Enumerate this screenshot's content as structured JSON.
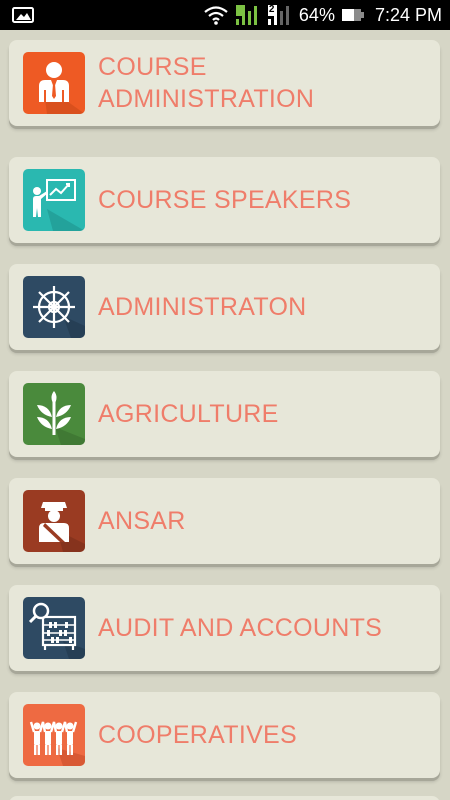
{
  "status_bar": {
    "battery_percent": "64%",
    "time": "7:24 PM",
    "sim2_label": "2",
    "icons": [
      "gallery-icon",
      "wifi-icon",
      "signal-sim1-icon",
      "signal-sim2-icon",
      "battery-icon"
    ]
  },
  "menu": {
    "items": [
      {
        "label": "COURSE ADMINISTRATION",
        "icon": "person-tie-icon",
        "tile_color": "#ee5a24"
      },
      {
        "label": "COURSE SPEAKERS",
        "icon": "presenter-board-icon",
        "tile_color": "#2ab8b0"
      },
      {
        "label": "ADMINISTRATON",
        "icon": "ship-wheel-icon",
        "tile_color": "#2e4a63"
      },
      {
        "label": "AGRICULTURE",
        "icon": "plant-sprout-icon",
        "tile_color": "#4a8a3c"
      },
      {
        "label": "ANSAR",
        "icon": "guard-officer-icon",
        "tile_color": "#9a3b22"
      },
      {
        "label": "AUDIT AND ACCOUNTS",
        "icon": "abacus-magnifier-icon",
        "tile_color": "#2e4a63"
      },
      {
        "label": "COOPERATIVES",
        "icon": "people-group-icon",
        "tile_color": "#ee6a42"
      }
    ]
  },
  "colors": {
    "label_text": "#ef7d6a",
    "card_background": "#e7e7d9",
    "page_background": "#d6d6c6"
  }
}
